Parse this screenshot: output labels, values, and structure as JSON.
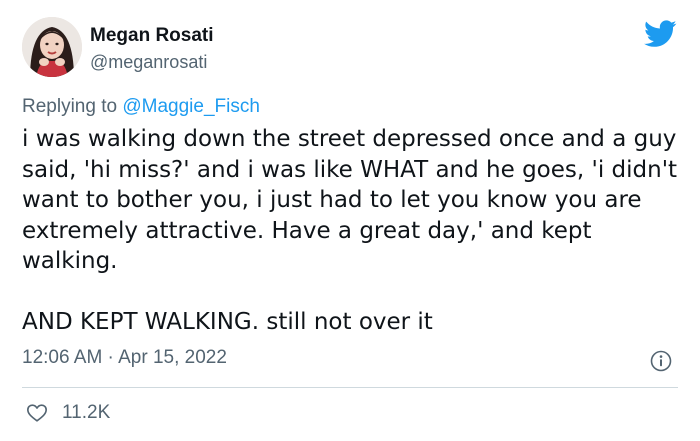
{
  "author": {
    "display_name": "Megan Rosati",
    "handle": "@meganrosati"
  },
  "reply": {
    "prefix": "Replying to ",
    "mention": "@Maggie_Fisch"
  },
  "tweet": {
    "paragraph_1": "i was walking down the street depressed once and a guy said, 'hi miss?' and i was like WHAT and he goes, 'i didn't want to bother you, i just had to let you know you are extremely attractive. Have a great day,' and kept walking.",
    "paragraph_2": "AND KEPT WALKING. still not over it",
    "time": "12:06 AM",
    "separator": " · ",
    "date": "Apr 15, 2022"
  },
  "engagement": {
    "likes": "11.2K"
  },
  "icons": {
    "brand": "twitter-bird-icon",
    "info": "info-icon",
    "like": "heart-icon"
  },
  "colors": {
    "brand_blue": "#1d9bf0",
    "text_primary": "#0f1419",
    "text_secondary": "#536471",
    "divider": "#cfd9de"
  }
}
